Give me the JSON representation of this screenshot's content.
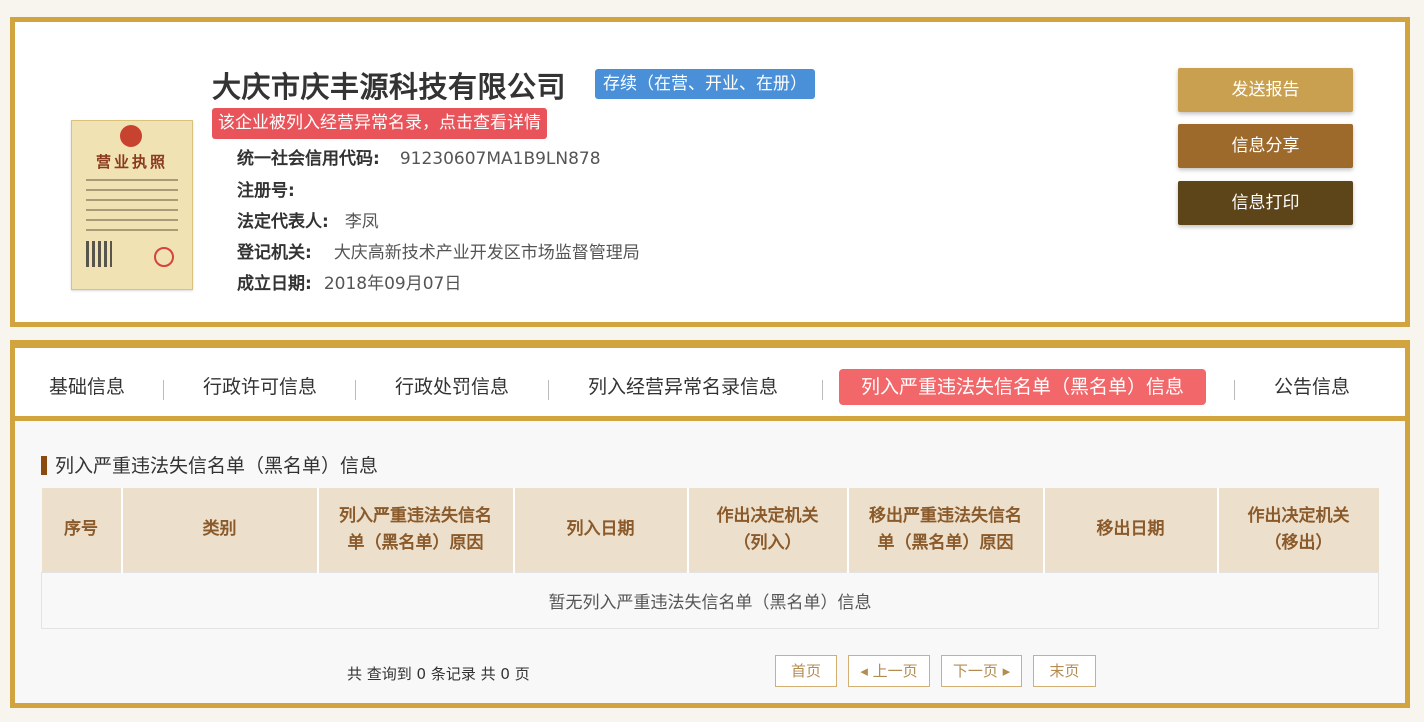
{
  "company": {
    "name": "大庆市庆丰源科技有限公司",
    "status": "存续（在营、开业、在册）",
    "abnormal_notice": "该企业被列入经营异常名录，点击查看详情",
    "license_title": "营业执照"
  },
  "details": [
    {
      "label": "统一社会信用代码:",
      "value": "91230607MA1B9LN878"
    },
    {
      "label": "注册号:",
      "value": ""
    },
    {
      "label": "法定代表人:",
      "value": "李凤"
    },
    {
      "label": "登记机关:",
      "value": "大庆高新技术产业开发区市场监督管理局"
    },
    {
      "label": "成立日期:",
      "value": "2018年09月07日"
    }
  ],
  "actions": {
    "send_report": "发送报告",
    "share": "信息分享",
    "print": "信息打印"
  },
  "tabs": [
    {
      "label": "基础信息",
      "active": false
    },
    {
      "label": "行政许可信息",
      "active": false
    },
    {
      "label": "行政处罚信息",
      "active": false
    },
    {
      "label": "列入经营异常名录信息",
      "active": false
    },
    {
      "label": "列入严重违法失信名单（黑名单）信息",
      "active": true
    },
    {
      "label": "公告信息",
      "active": false
    }
  ],
  "section": {
    "title": "列入严重违法失信名单（黑名单）信息",
    "columns": [
      "序号",
      "类别",
      "列入严重违法失信名单（黑名单）原因",
      "列入日期",
      "作出决定机关（列入）",
      "移出严重违法失信名单（黑名单）原因",
      "移出日期",
      "作出决定机关（移出）"
    ],
    "empty_text": "暂无列入严重违法失信名单（黑名单）信息"
  },
  "pagination": {
    "summary": "共 查询到 0 条记录 共 0 页",
    "first": "首页",
    "prev": "◂ 上一页",
    "next": "下一页 ▸",
    "last": "末页"
  },
  "colors": {
    "frame": "#d2a43f",
    "status_badge": "#4a90d9",
    "abnormal_banner": "#e8545a",
    "active_tab": "#f1676a",
    "btn_send": "#c9a050",
    "btn_share": "#9d6a2b",
    "btn_print": "#5e4519"
  }
}
